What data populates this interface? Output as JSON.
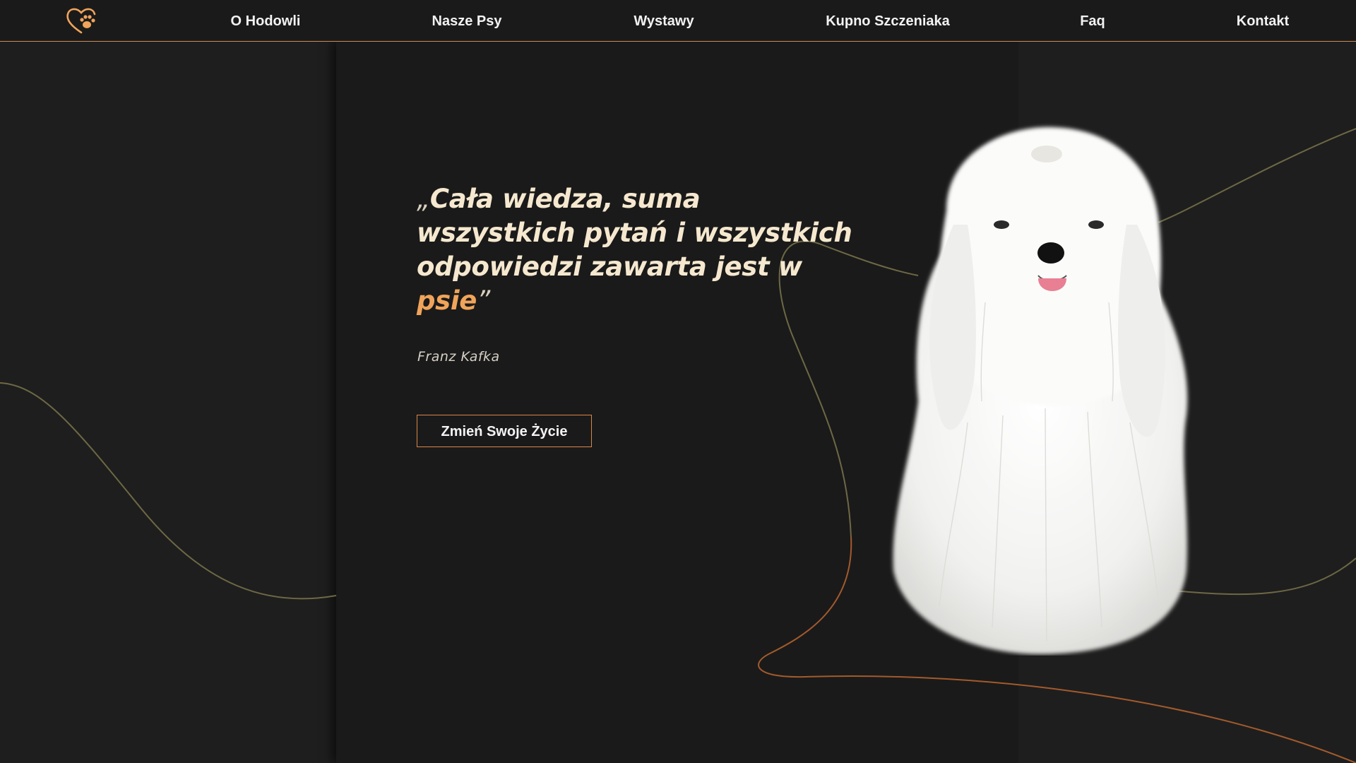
{
  "nav": {
    "logo_icon": "heart-paw-icon",
    "links": [
      "O Hodowli",
      "Nasze Psy",
      "Wystawy",
      "Kupno Szczeniaka",
      "Faq",
      "Kontakt"
    ]
  },
  "hero": {
    "quote_open": "„",
    "quote_main": "Cała wiedza, suma wszystkich pytań i wszystkich odpowiedzi zawarta jest w ",
    "quote_accent": "psie",
    "quote_close": "”",
    "author": "Franz Kafka",
    "cta_label": "Zmień Swoje Życie"
  },
  "colors": {
    "accent": "#f0a45a",
    "nav_border": "#d08a52",
    "curve_olive": "#6e6845",
    "curve_orange": "#a35a2c"
  }
}
